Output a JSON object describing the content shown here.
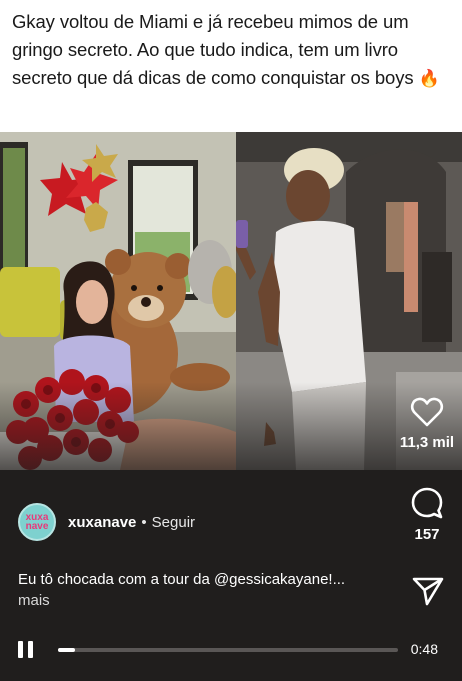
{
  "caption": {
    "text": "Gkay voltou de Miami e já recebeu mimos de um gringo secreto. Ao que tudo indica, tem um livro secreto que dá dicas de como conquistar os boys",
    "emoji": "🔥"
  },
  "post": {
    "account": {
      "avatar_text": "xuxa nave",
      "username": "xuxanave",
      "separator": "•",
      "follow_label": "Seguir"
    },
    "description": {
      "text": "Eu tô chocada com a tour da @gessicakayane!...",
      "more_label": "mais"
    },
    "actions": {
      "like_count": "11,3 mil",
      "comment_count": "157"
    },
    "player": {
      "time": "0:48",
      "progress": 0.05
    }
  },
  "colors": {
    "background": "#201e1d",
    "avatar": "#7ed1cf",
    "avatar_text": "#e8397a",
    "roses": "#b0141c",
    "balloons": "#d4242b"
  },
  "icons": [
    "heart-icon",
    "comment-icon",
    "share-icon",
    "pause-icon"
  ]
}
